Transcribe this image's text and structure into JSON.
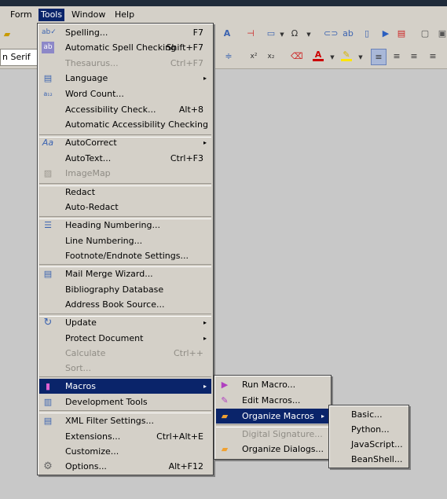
{
  "menubar": {
    "items": [
      {
        "label": "Form"
      },
      {
        "label": "Tools"
      },
      {
        "label": "Window"
      },
      {
        "label": "Help"
      }
    ]
  },
  "toolbar": {
    "font_name": "n Serif"
  },
  "tools_menu": {
    "items": [
      {
        "label": "Spelling...",
        "shortcut": "F7",
        "icon": "spelling-icon"
      },
      {
        "label": "Automatic Spell Checking",
        "shortcut": "Shift+F7",
        "icon": "auto-spell-icon"
      },
      {
        "label": "Thesaurus...",
        "shortcut": "Ctrl+F7",
        "disabled": true
      },
      {
        "label": "Language",
        "submenu": true,
        "icon": "language-icon"
      },
      {
        "label": "Word Count...",
        "icon": "word-count-icon"
      },
      {
        "label": "Accessibility Check...",
        "shortcut": "Alt+8"
      },
      {
        "label": "Automatic Accessibility Checking"
      },
      {
        "label": "AutoCorrect",
        "submenu": true,
        "icon": "autocorrect-icon"
      },
      {
        "label": "AutoText...",
        "shortcut": "Ctrl+F3"
      },
      {
        "label": "ImageMap",
        "disabled": true,
        "icon": "imagemap-icon"
      },
      {
        "label": "Redact"
      },
      {
        "label": "Auto-Redact"
      },
      {
        "label": "Heading Numbering...",
        "icon": "heading-numbering-icon"
      },
      {
        "label": "Line Numbering..."
      },
      {
        "label": "Footnote/Endnote Settings..."
      },
      {
        "label": "Mail Merge Wizard...",
        "icon": "mail-merge-icon"
      },
      {
        "label": "Bibliography Database"
      },
      {
        "label": "Address Book Source..."
      },
      {
        "label": "Update",
        "submenu": true,
        "icon": "update-icon"
      },
      {
        "label": "Protect Document",
        "submenu": true
      },
      {
        "label": "Calculate",
        "shortcut": "Ctrl++",
        "disabled": true
      },
      {
        "label": "Sort...",
        "disabled": true
      },
      {
        "label": "Macros",
        "submenu": true,
        "highlighted": true,
        "icon": "macros-icon"
      },
      {
        "label": "Development Tools",
        "icon": "development-tools-icon"
      },
      {
        "label": "XML Filter Settings...",
        "icon": "xml-filter-icon"
      },
      {
        "label": "Extensions...",
        "shortcut": "Ctrl+Alt+E"
      },
      {
        "label": "Customize..."
      },
      {
        "label": "Options...",
        "shortcut": "Alt+F12",
        "icon": "options-icon"
      }
    ]
  },
  "macros_menu": {
    "items": [
      {
        "label": "Run Macro...",
        "icon": "run-macro-icon"
      },
      {
        "label": "Edit Macros...",
        "icon": "edit-macros-icon"
      },
      {
        "label": "Organize Macros",
        "submenu": true,
        "highlighted": true,
        "icon": "organize-macros-icon"
      },
      {
        "label": "Digital Signature...",
        "disabled": true
      },
      {
        "label": "Organize Dialogs...",
        "icon": "organize-dialogs-icon"
      }
    ]
  },
  "organize_menu": {
    "items": [
      {
        "label": "Basic..."
      },
      {
        "label": "Python..."
      },
      {
        "label": "JavaScript..."
      },
      {
        "label": "BeanShell..."
      }
    ]
  },
  "colors": {
    "highlight": "#0a246a",
    "menu_bg": "#d4d0c8",
    "disabled_text": "#8f8c85"
  }
}
